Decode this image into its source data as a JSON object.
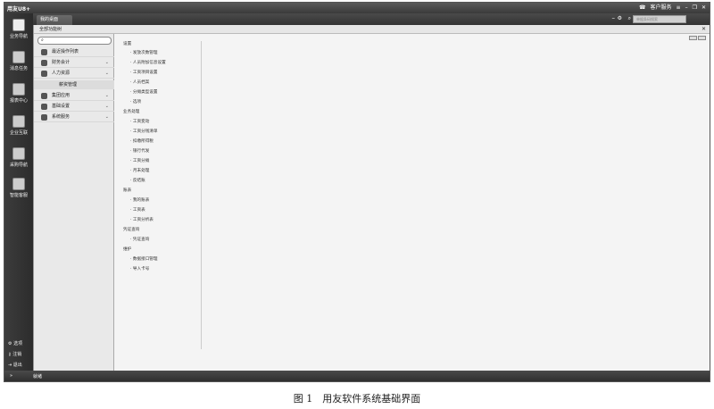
{
  "titlebar": {
    "logo": "用友U8+",
    "account_label": "客户服务",
    "controls": [
      "≡",
      "–",
      "❐",
      "✕"
    ]
  },
  "tabbar": {
    "home_tab": "我的桌面",
    "search_placeholder": "单据条码搜索"
  },
  "rail": {
    "items": [
      {
        "label": "业务导航",
        "icon": "business-nav-icon"
      },
      {
        "label": "消息任务",
        "icon": "message-task-icon"
      },
      {
        "label": "报表中心",
        "icon": "report-center-icon"
      },
      {
        "label": "企业互联",
        "icon": "enterprise-connect-icon"
      },
      {
        "label": "采购导航",
        "icon": "purchase-nav-icon"
      },
      {
        "label": "智能客服",
        "icon": "smart-service-icon"
      }
    ],
    "bottom": [
      {
        "label": "选项",
        "icon": "gear-icon"
      },
      {
        "label": "注销",
        "icon": "key-icon"
      },
      {
        "label": "退出",
        "icon": "exit-icon"
      }
    ]
  },
  "content": {
    "header_title": "全部功能树"
  },
  "tree": {
    "search_value": "",
    "items": [
      {
        "label": "最近操作列表",
        "chevron": ""
      },
      {
        "label": "财务会计",
        "chevron": "⌄"
      },
      {
        "label": "人力资源",
        "chevron": "⌄"
      },
      {
        "label": "薪资管理",
        "child": true
      },
      {
        "label": "集团应用",
        "chevron": "⌄"
      },
      {
        "label": "基础设置",
        "chevron": "⌄"
      },
      {
        "label": "系统服务",
        "chevron": "⌄"
      }
    ]
  },
  "menu": {
    "groups": [
      {
        "title": "设置",
        "items": [
          "发放次数管理",
          "人员附加信息设置",
          "工资项目设置",
          "人员档案",
          "分摊类型设置",
          "选项"
        ]
      },
      {
        "title": "业务处理",
        "items": [
          "工资变动",
          "工资分钱清单",
          "扣缴所得税",
          "银行代发",
          "工资分摊",
          "月末处理",
          "反结账"
        ]
      },
      {
        "title": "账表",
        "items": [
          "我的账表",
          "工资表",
          "工资分析表"
        ]
      },
      {
        "title": "凭证查询",
        "items": [
          "凭证查询"
        ]
      },
      {
        "title": "维护",
        "items": [
          "数据接口管理",
          "导入卡号"
        ]
      }
    ]
  },
  "statusbar": {
    "text": "就绪",
    "arrows": "»"
  },
  "caption": "图 1　用友软件系统基础界面"
}
